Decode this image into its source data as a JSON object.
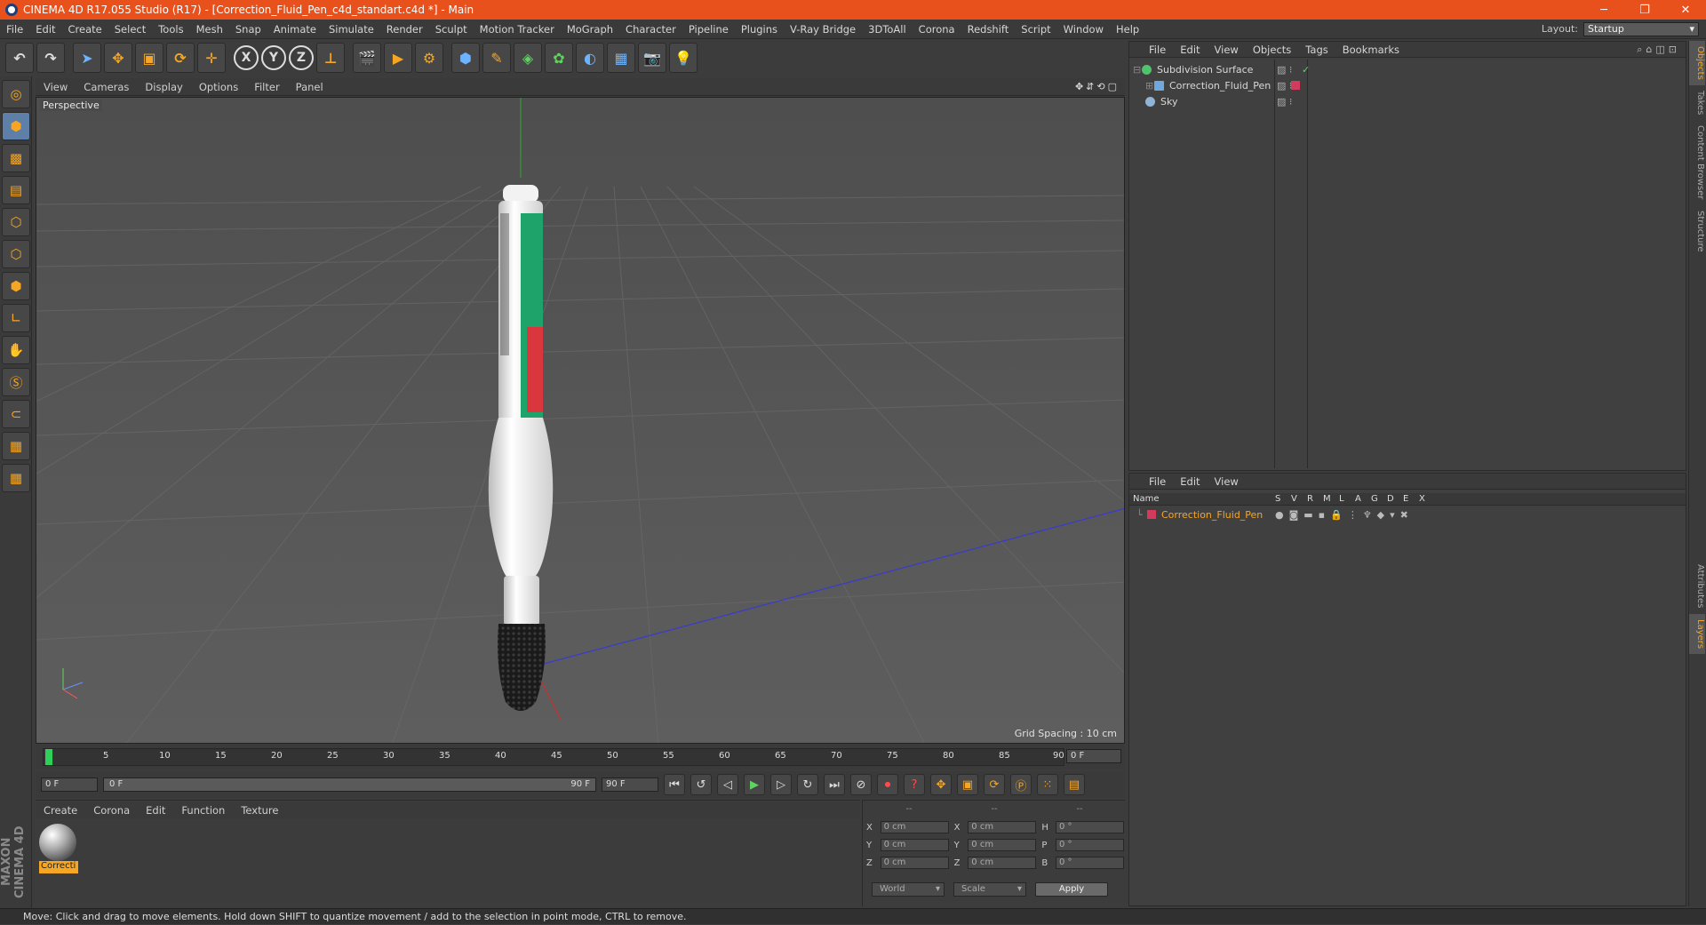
{
  "window": {
    "title": "CINEMA 4D R17.055 Studio (R17) - [Correction_Fluid_Pen_c4d_standart.c4d *] - Main",
    "controls": [
      "─",
      "❐",
      "✕"
    ]
  },
  "menubar": {
    "items": [
      "File",
      "Edit",
      "Create",
      "Select",
      "Tools",
      "Mesh",
      "Snap",
      "Animate",
      "Simulate",
      "Render",
      "Sculpt",
      "Motion Tracker",
      "MoGraph",
      "Character",
      "Pipeline",
      "Plugins",
      "V-Ray Bridge",
      "3DToAll",
      "Corona",
      "Redshift",
      "Script",
      "Window",
      "Help"
    ],
    "layout_label": "Layout:",
    "layout_value": "Startup"
  },
  "viewport": {
    "menu": [
      "View",
      "Cameras",
      "Display",
      "Options",
      "Filter",
      "Panel"
    ],
    "nav_icons": "✥⇵⟲▢",
    "label": "Perspective",
    "grid_spacing": "Grid Spacing : 10 cm"
  },
  "timeline": {
    "ticks": [
      "0",
      "5",
      "10",
      "15",
      "20",
      "25",
      "30",
      "35",
      "40",
      "45",
      "50",
      "55",
      "60",
      "65",
      "70",
      "75",
      "80",
      "85",
      "90"
    ],
    "current_frame": "0 F"
  },
  "playbar": {
    "start": "0 F",
    "range_start": "0 F",
    "range_end": "90 F",
    "end": "90 F"
  },
  "material_panel": {
    "menu": [
      "Create",
      "Corona",
      "Edit",
      "Function",
      "Texture"
    ],
    "material_name": "Correcti"
  },
  "coordinates": {
    "headers": [
      "--",
      "--",
      "--"
    ],
    "rows": [
      {
        "a1": "X",
        "v1": "0 cm",
        "a2": "X",
        "v2": "0 cm",
        "a3": "H",
        "v3": "0 °"
      },
      {
        "a1": "Y",
        "v1": "0 cm",
        "a2": "Y",
        "v2": "0 cm",
        "a3": "P",
        "v3": "0 °"
      },
      {
        "a1": "Z",
        "v1": "0 cm",
        "a2": "Z",
        "v2": "0 cm",
        "a3": "B",
        "v3": "0 °"
      }
    ],
    "mode": "World",
    "scale": "Scale",
    "apply": "Apply"
  },
  "status": "Move: Click and drag to move elements. Hold down SHIFT to quantize movement / add to the selection in point mode, CTRL to remove.",
  "objects_panel": {
    "menu": [
      "File",
      "Edit",
      "View",
      "Objects",
      "Tags",
      "Bookmarks"
    ],
    "items": [
      {
        "name": "Subdivision Surface",
        "icon_color": "#4fc36b"
      },
      {
        "name": "Correction_Fluid_Pen",
        "icon_color": "#6fa8dc"
      },
      {
        "name": "Sky",
        "icon_color": "#8fb4d8"
      }
    ]
  },
  "layers_panel": {
    "menu": [
      "File",
      "Edit",
      "View"
    ],
    "columns": [
      "Name",
      "S",
      "V",
      "R",
      "M",
      "L",
      "A",
      "G",
      "D",
      "E",
      "X"
    ],
    "layer_name": "Correction_Fluid_Pen",
    "layer_color": "#d23b5b"
  },
  "right_tabs": [
    "Objects",
    "Takes",
    "Content Browser",
    "Structure",
    "Attributes",
    "Layers"
  ],
  "brand": "MAXON CINEMA 4D",
  "colors": {
    "accent": "#f6a623",
    "titlebar": "#e8501c"
  }
}
